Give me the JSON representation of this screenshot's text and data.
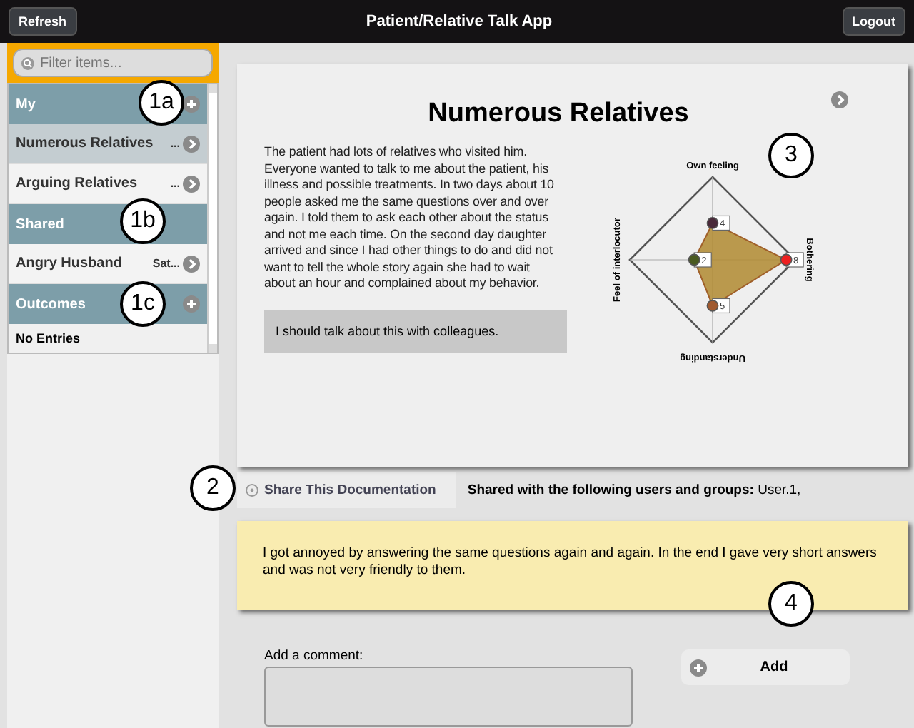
{
  "top_bar": {
    "title": "Patient/Relative Talk App",
    "left_button": "Refresh",
    "right_button": "Logout"
  },
  "sidebar": {
    "filter": {
      "placeholder": "Filter items..."
    },
    "items": [
      {
        "kind": "section",
        "label": "My",
        "addable": true
      },
      {
        "kind": "entry",
        "label": "Numerous Relatives",
        "note": "...",
        "selected": true
      },
      {
        "kind": "entry",
        "label": "Arguing Relatives",
        "note": "...",
        "selected": false
      },
      {
        "kind": "section",
        "label": "Shared",
        "addable": false
      },
      {
        "kind": "entry",
        "label": "Angry Husband",
        "note": "Sat...",
        "selected": false
      },
      {
        "kind": "section",
        "label": "Outcomes",
        "addable": true
      },
      {
        "kind": "empty",
        "label": "No Entries"
      }
    ]
  },
  "document": {
    "title": "Numerous Relatives",
    "text": "The patient had lots of relatives who visited him. Everyone wanted to talk to me about the patient, his illness and possible treatments. In two days about 10 people asked me the same questions over and over again. I told them to ask each other about the status and not me each time. On the second day daughter arrived and since I had other things to do and did not want to tell the whole story again she had to wait about an hour and complained about my behavior.",
    "conclusion": "I should talk about this with colleagues.",
    "radar": [
      {
        "axis": "Own feeling",
        "value": "4",
        "color": "#4a2a3a"
      },
      {
        "axis": "Bothering",
        "value": "8",
        "color": "#ee2020"
      },
      {
        "axis": "Understanding",
        "value": "5",
        "color": "#a05a30"
      },
      {
        "axis": "Feel of interlocutor",
        "value": "2",
        "color": "#4a5a20"
      }
    ]
  },
  "share": {
    "button": "Share This Documentation",
    "label": "Shared with the following users and groups:",
    "users": "User.1,"
  },
  "note": "I got annoyed by answering the same questions again and again. In the end I gave very short answers and was not very friendly to them.",
  "comment": {
    "label": "Add a comment:",
    "button": "Add"
  },
  "callouts": [
    "1a",
    "1b",
    "1c",
    "2",
    "3",
    "4"
  ]
}
